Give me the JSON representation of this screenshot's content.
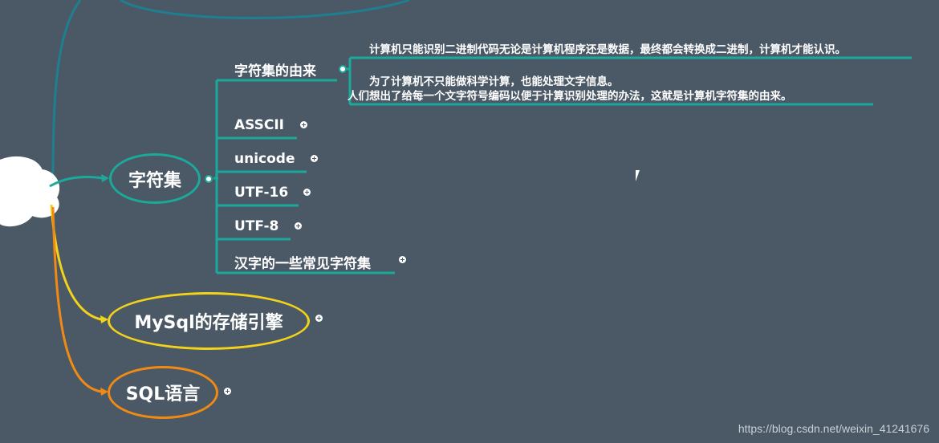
{
  "root": {
    "label": ""
  },
  "charset": {
    "label": "字符集",
    "origin": {
      "label": "字符集的由来",
      "note1": "计算机只能识别二进制代码无论是计算机程序还是数据，最终都会转换成二进制，计算机才能认识。",
      "note2_line1": "为了计算机不只能做科学计算，也能处理文字信息。",
      "note2_line2": "人们想出了给每一个文字符号编码以便于计算识别处理的办法，这就是计算机字符集的由来。"
    },
    "items": [
      "ASSCII",
      "unicode",
      "UTF-16",
      "UTF-8",
      "汉字的一些常见字符集"
    ]
  },
  "mysql": {
    "label": "MySql的存储引擎"
  },
  "sql": {
    "label": "SQL语言"
  },
  "colors": {
    "background": "#4b5966",
    "teal": "#1aa99a",
    "teal_dark": "#1f7f90",
    "yellow": "#f2d21b",
    "orange": "#f08a12"
  },
  "watermark": "https://blog.csdn.net/weixin_41241676"
}
